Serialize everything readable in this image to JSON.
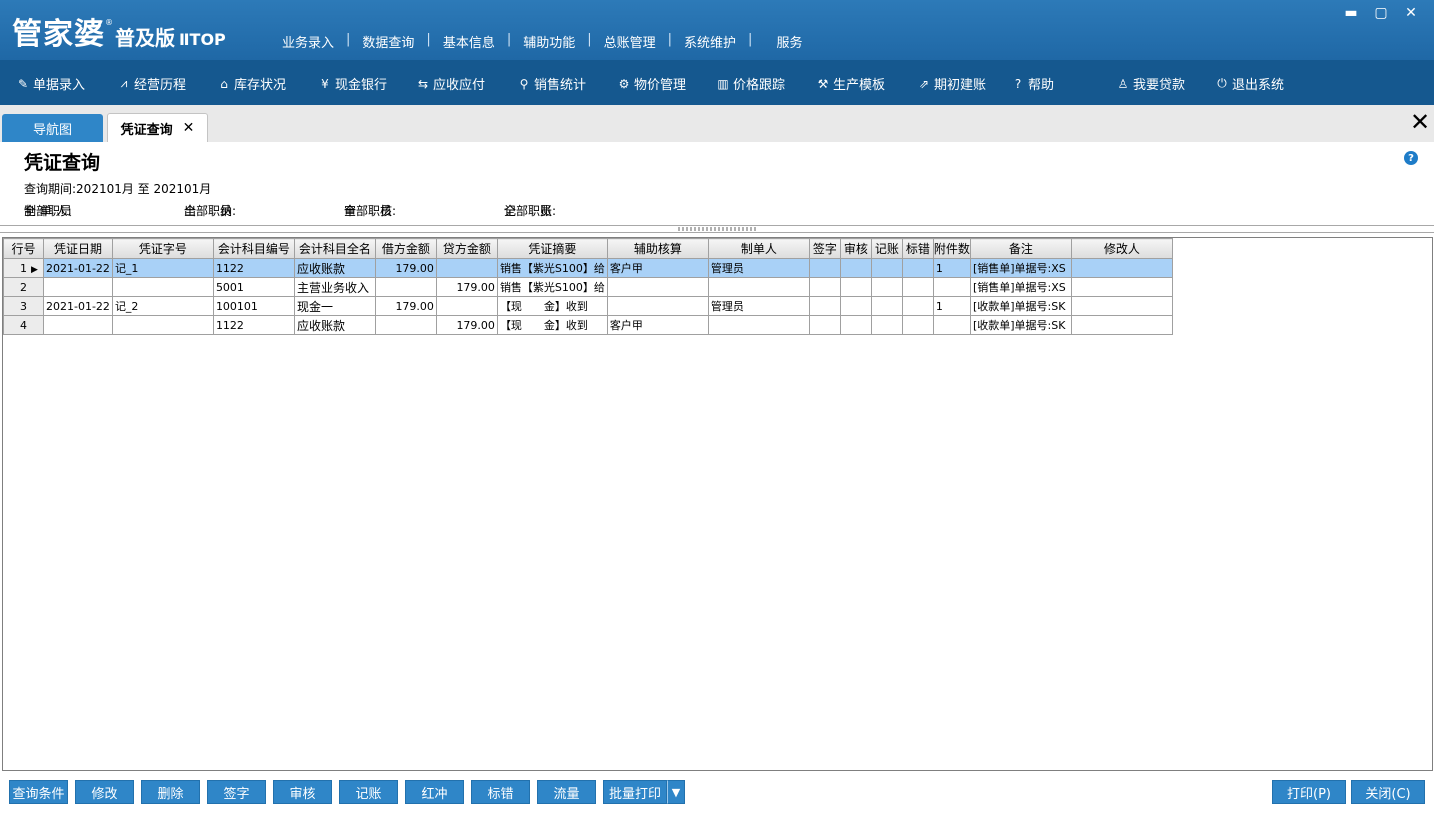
{
  "app": {
    "logo_main": "管家婆",
    "logo_sub": "普及版",
    "logo_ver": "ⅡTOP",
    "top_menu": [
      "业务录入",
      "数据查询",
      "基本信息",
      "辅助功能",
      "总账管理",
      "系统维护",
      "服务"
    ]
  },
  "toolbar": {
    "items": [
      {
        "label": "单据录入",
        "icon": "edit-icon"
      },
      {
        "label": "经营历程",
        "icon": "chart-line-icon"
      },
      {
        "label": "库存状况",
        "icon": "home-icon"
      },
      {
        "label": "现金银行",
        "icon": "yen-icon"
      },
      {
        "label": "应收应付",
        "icon": "exchange-icon"
      },
      {
        "label": "销售统计",
        "icon": "search-icon"
      },
      {
        "label": "物价管理",
        "icon": "gear-icon"
      },
      {
        "label": "价格跟踪",
        "icon": "bar-chart-icon"
      },
      {
        "label": "生产模板",
        "icon": "wrench-icon"
      },
      {
        "label": "期初建账",
        "icon": "external-link-icon"
      },
      {
        "label": "帮助",
        "icon": "question-icon"
      },
      {
        "label": "我要贷款",
        "icon": "money-bag-icon"
      },
      {
        "label": "退出系统",
        "icon": "power-icon"
      }
    ]
  },
  "tabs": {
    "nav": "导航图",
    "active": "凭证查询"
  },
  "page": {
    "title": "凭证查询",
    "period_label": "查询期间:",
    "period_value": "202101月 至 202101月",
    "filters": {
      "maker_label": "制 单 人:",
      "maker_value": "全部职员",
      "cashier_label": "出　　纳:",
      "cashier_value": "全部职员",
      "auditor_label": "审　　核:",
      "auditor_value": "全部职员",
      "poster_label": "记　　账:",
      "poster_value": "全部职员"
    }
  },
  "grid": {
    "columns": [
      "行号",
      "凭证日期",
      "凭证字号",
      "会计科目编号",
      "会计科目全名",
      "借方金额",
      "贷方金额",
      "凭证摘要",
      "辅助核算",
      "制单人",
      "签字",
      "审核",
      "记账",
      "标错",
      "附件数",
      "备注",
      "修改人"
    ],
    "rows": [
      {
        "no": "1",
        "date": "2021-01-22",
        "voucher": "记_1",
        "code": "1122",
        "name": "应收账款",
        "debit": "179.00",
        "credit": "",
        "summary": "销售【紫光S100】给",
        "aux": "客户甲",
        "maker": "管理员",
        "sign": "",
        "audit": "",
        "post": "",
        "err": "",
        "attach": "1",
        "note": "[销售单]单据号:XS",
        "modifier": ""
      },
      {
        "no": "2",
        "date": "",
        "voucher": "",
        "code": "5001",
        "name": "主营业务收入",
        "debit": "",
        "credit": "179.00",
        "summary": "销售【紫光S100】给",
        "aux": "",
        "maker": "",
        "sign": "",
        "audit": "",
        "post": "",
        "err": "",
        "attach": "",
        "note": "[销售单]单据号:XS",
        "modifier": ""
      },
      {
        "no": "3",
        "date": "2021-01-22",
        "voucher": "记_2",
        "code": "100101",
        "name": "现金一",
        "debit": "179.00",
        "credit": "",
        "summary": "【现　　金】收到",
        "aux": "",
        "maker": "管理员",
        "sign": "",
        "audit": "",
        "post": "",
        "err": "",
        "attach": "1",
        "note": "[收款单]单据号:SK",
        "modifier": ""
      },
      {
        "no": "4",
        "date": "",
        "voucher": "",
        "code": "1122",
        "name": "应收账款",
        "debit": "",
        "credit": "179.00",
        "summary": "【现　　金】收到",
        "aux": "客户甲",
        "maker": "",
        "sign": "",
        "audit": "",
        "post": "",
        "err": "",
        "attach": "",
        "note": "[收款单]单据号:SK",
        "modifier": ""
      }
    ]
  },
  "buttons": {
    "left": [
      "查询条件",
      "修改",
      "删除",
      "签字",
      "审核",
      "记账",
      "红冲",
      "标错",
      "流量",
      "批量打印"
    ],
    "print": "打印(P)",
    "close": "关闭(C)"
  },
  "colors": {
    "title_bar": "#2d7ab8",
    "toolbar": "#15588f",
    "button": "#2f86c8",
    "selected_row": "#a9d1f7"
  }
}
